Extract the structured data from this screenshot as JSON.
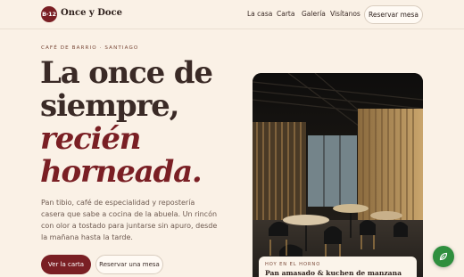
{
  "header": {
    "logo_mark": "B·12",
    "brand": "Once y Doce",
    "nav": [
      "La casa",
      "Carta",
      "Galería",
      "Visítanos"
    ],
    "cta": "Reservar mesa"
  },
  "hero": {
    "eyebrow": "CAFÉ DE BARRIO · SANTIAGO",
    "headline_line1": "La once de",
    "headline_line2": "siempre,",
    "headline_accent1": "recién",
    "headline_accent2": "horneada.",
    "lede": "Pan tibio, café de especialidad y repostería casera que sabe a cocina de la abuela. Un rincón con olor a tostado para juntarse sin apuro, desde la mañana hasta la tarde.",
    "primary_cta": "Ver la carta",
    "secondary_cta": "Reservar una mesa"
  },
  "feature": {
    "eyebrow": "HOY EN EL HORNO",
    "title": "Pan amasado & kuchen de manzana"
  },
  "colors": {
    "background": "#faf1e6",
    "accent": "#7a1f24",
    "chat": "#2f8f3e"
  }
}
